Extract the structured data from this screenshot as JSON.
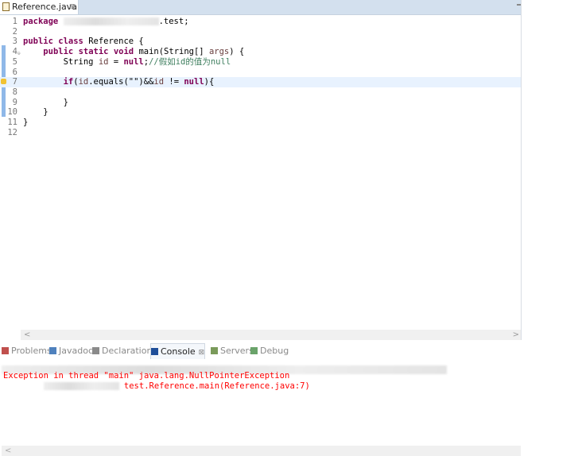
{
  "editor": {
    "tab_label": "Reference.java",
    "tab_close": "⊠",
    "lines": [
      {
        "n": "1",
        "tokens": [
          {
            "t": "package",
            "c": "kw"
          },
          {
            "t": " "
          },
          {
            "blur": 120
          },
          {
            "t": ".test;"
          }
        ]
      },
      {
        "n": "2",
        "tokens": []
      },
      {
        "n": "3",
        "tokens": [
          {
            "t": "public",
            "c": "kw"
          },
          {
            "t": " "
          },
          {
            "t": "class",
            "c": "kw"
          },
          {
            "t": " Reference {"
          }
        ]
      },
      {
        "n": "4",
        "fold": true,
        "tokens": [
          {
            "t": "    "
          },
          {
            "t": "public",
            "c": "kw"
          },
          {
            "t": " "
          },
          {
            "t": "static",
            "c": "kw"
          },
          {
            "t": " "
          },
          {
            "t": "void",
            "c": "kw"
          },
          {
            "t": " main(String[] "
          },
          {
            "t": "args",
            "c": "var"
          },
          {
            "t": ") {"
          }
        ]
      },
      {
        "n": "5",
        "tokens": [
          {
            "t": "        String "
          },
          {
            "t": "id",
            "c": "var"
          },
          {
            "t": " = "
          },
          {
            "t": "null",
            "c": "kw"
          },
          {
            "t": ";"
          },
          {
            "t": "//假如id的值为null",
            "c": "cm"
          }
        ]
      },
      {
        "n": "6",
        "tokens": []
      },
      {
        "n": "7",
        "current": true,
        "warning": true,
        "tokens": [
          {
            "t": "        "
          },
          {
            "t": "if",
            "c": "kw"
          },
          {
            "t": "("
          },
          {
            "t": "id",
            "c": "var"
          },
          {
            "t": ".equals(\"\")&&"
          },
          {
            "t": "id",
            "c": "var"
          },
          {
            "t": " != "
          },
          {
            "t": "null",
            "c": "kw"
          },
          {
            "t": "){"
          }
        ]
      },
      {
        "n": "8",
        "tokens": []
      },
      {
        "n": "9",
        "tokens": [
          {
            "t": "        }"
          }
        ]
      },
      {
        "n": "10",
        "tokens": [
          {
            "t": "    }"
          }
        ]
      },
      {
        "n": "11",
        "tokens": [
          {
            "t": "}"
          }
        ]
      },
      {
        "n": "12",
        "tokens": []
      }
    ],
    "scroll_left": "<",
    "scroll_right": ">"
  },
  "views": {
    "tabs": [
      {
        "label": "Problems",
        "icon": "problems-icon",
        "color": "#c0504d"
      },
      {
        "label": "Javadoc",
        "icon": "javadoc-icon",
        "color": "#4f81bd"
      },
      {
        "label": "Declaration",
        "icon": "declaration-icon",
        "color": "#8a8a8a"
      },
      {
        "label": "Console",
        "icon": "console-icon",
        "color": "#1f4e99",
        "active": true
      },
      {
        "label": "Servers",
        "icon": "servers-icon",
        "color": "#7a9a5a"
      },
      {
        "label": "Debug",
        "icon": "debug-icon",
        "color": "#6aa36a"
      }
    ],
    "close": "⊠"
  },
  "console": {
    "lines": [
      "Exception in thread \"main\" java.lang.NullPointerException",
      "test.Reference.main(Reference.java:7)"
    ],
    "scroll_left": "<",
    "error_color": "#ff0000"
  }
}
